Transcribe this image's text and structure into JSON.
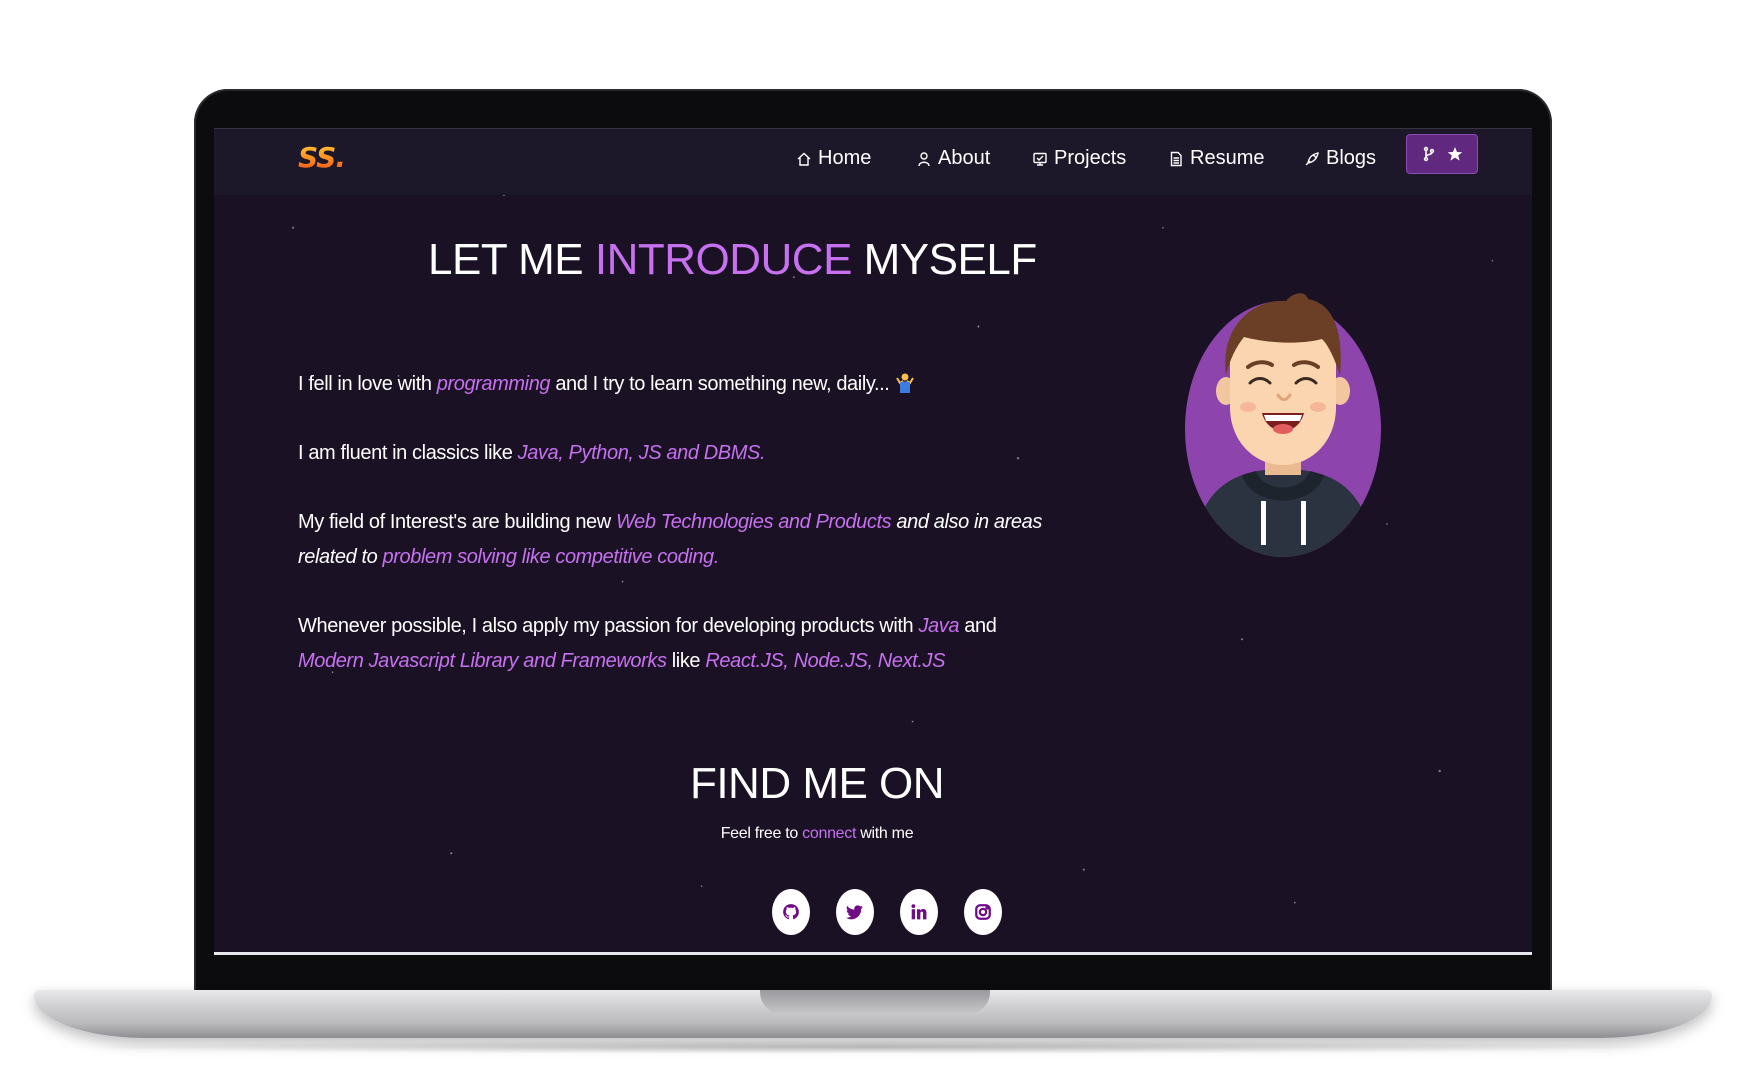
{
  "logo": {
    "text": "SS."
  },
  "nav": {
    "items": [
      {
        "label": "Home",
        "icon": "home-icon"
      },
      {
        "label": "About",
        "icon": "user-icon"
      },
      {
        "label": "Projects",
        "icon": "projects-icon"
      },
      {
        "label": "Resume",
        "icon": "document-icon"
      },
      {
        "label": "Blogs",
        "icon": "blogs-icon"
      }
    ],
    "fork_button": {
      "icons": [
        "git-fork-icon",
        "star-icon"
      ]
    }
  },
  "about": {
    "heading": {
      "part1": "LET ME",
      "highlight": "INTRODUCE",
      "part2": "MYSELF"
    },
    "p1": {
      "t1": "I fell in love with ",
      "em1": "programming",
      "t2": " and I try to learn something new, daily... "
    },
    "p2": {
      "t1": "I am fluent in classics like ",
      "em1": "Java, Python, JS and DBMS."
    },
    "p3": {
      "t1": "My field of Interest's are building new  ",
      "em1": "Web Technologies and Products",
      "t2": " and also in areas related to ",
      "em2": "problem solving like competitive coding."
    },
    "p4": {
      "t1": "Whenever possible, I also apply my passion for developing products with ",
      "em1": "Java",
      "t2": " and ",
      "em2": "Modern Javascript Library and Frameworks",
      "t3": "  like ",
      "em3": "React.JS, Node.JS, Next.JS"
    }
  },
  "find": {
    "title": "FIND ME ON",
    "sub_before": "Feel free to ",
    "sub_link": "connect",
    "sub_after": " with me",
    "socials": [
      "github-icon",
      "twitter-icon",
      "linkedin-icon",
      "instagram-icon"
    ]
  },
  "colors": {
    "accent": "#c770f0",
    "background": "#1a1124",
    "navbar": "#1c1729",
    "fork_button": "#60287f",
    "social_icon": "#700c86"
  }
}
